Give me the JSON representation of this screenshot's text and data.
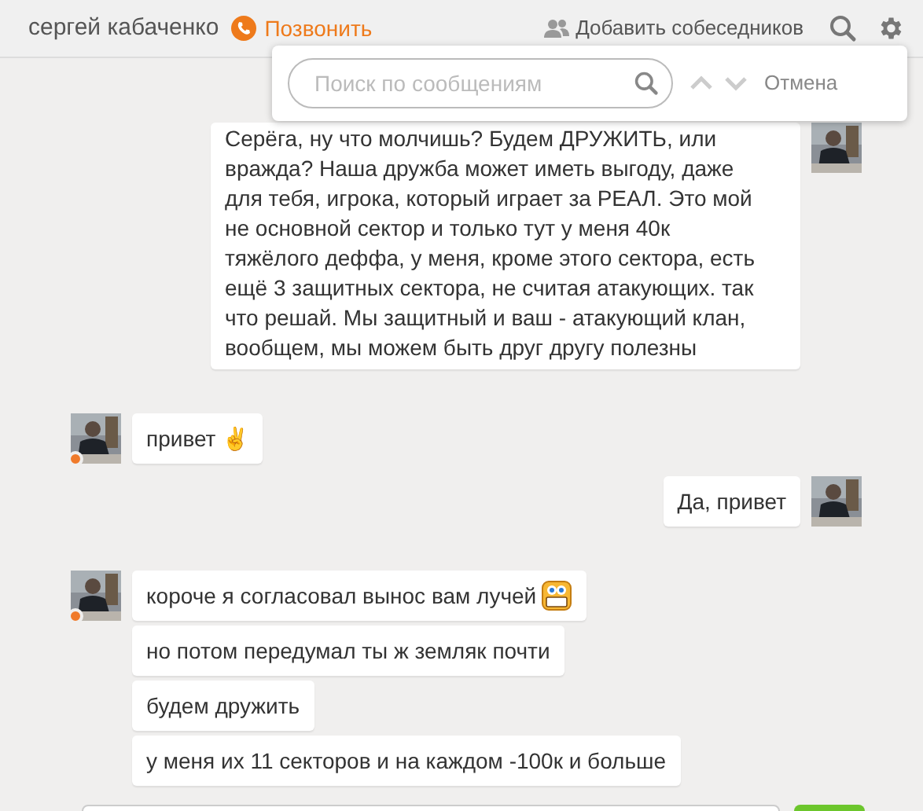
{
  "header": {
    "contact_name": "сергей кабаченко",
    "call_label": "Позвонить",
    "add_label": "Добавить собеседников"
  },
  "search": {
    "placeholder": "Поиск по сообщениям",
    "cancel": "Отмена"
  },
  "groups": [
    {
      "kind": "outgoing",
      "online": false,
      "bubbles": [
        {
          "text": "Серёга, ну что молчишь? Будем ДРУЖИТЬ, или вражда? Наша дружба может иметь выгоду, даже для тебя, игрока, который играет за РЕАЛ. Это мой не основной сектор и только тут у меня 40к тяжёлого деффа, у меня, кроме этого сектора, есть ещё 3 защитных сектора, не считая атакующих. так что решай. Мы защитный и ваш - атакующий клан, вообщем, мы можем быть друг другу полезны"
        }
      ]
    },
    {
      "kind": "incoming",
      "online": true,
      "bubbles": [
        {
          "text": "привет ✌"
        }
      ]
    },
    {
      "kind": "outgoing",
      "online": false,
      "bubbles": [
        {
          "text": "Да, привет"
        }
      ]
    },
    {
      "kind": "incoming",
      "online": true,
      "bubbles": [
        {
          "kind": "grin",
          "text": "короче я согласовал вынос вам лучей"
        },
        {
          "kind": "plain",
          "text": "но потом передумал ты ж земляк почти"
        },
        {
          "kind": "plain",
          "text": "будем дружить"
        },
        {
          "kind": "plain",
          "text": "у меня их 11 секторов и на каждом -100к и больше"
        }
      ]
    }
  ]
}
